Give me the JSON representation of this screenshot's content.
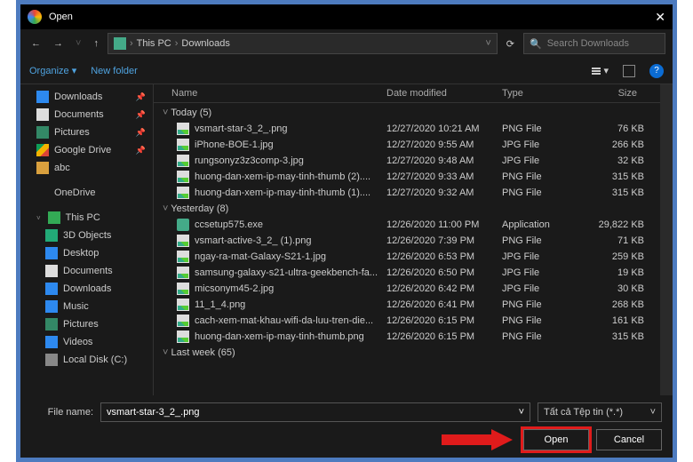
{
  "title": "Open",
  "breadcrumb": [
    "This PC",
    "Downloads"
  ],
  "search_placeholder": "Search Downloads",
  "toolbar": {
    "organize": "Organize",
    "newfolder": "New folder"
  },
  "columns": {
    "name": "Name",
    "date": "Date modified",
    "type": "Type",
    "size": "Size"
  },
  "sidebar": [
    {
      "icon": "dl",
      "label": "Downloads",
      "pin": true
    },
    {
      "icon": "doc",
      "label": "Documents",
      "pin": true
    },
    {
      "icon": "pic",
      "label": "Pictures",
      "pin": true
    },
    {
      "icon": "gd",
      "label": "Google Drive",
      "pin": true
    },
    {
      "icon": "fld",
      "label": "abc"
    },
    {
      "icon": "od",
      "label": "OneDrive",
      "spaced": true
    },
    {
      "icon": "pc",
      "label": "This PC",
      "spaced": true,
      "exp": true
    },
    {
      "icon": "obj",
      "label": "3D Objects",
      "sub": true
    },
    {
      "icon": "dsk",
      "label": "Desktop",
      "sub": true
    },
    {
      "icon": "doc",
      "label": "Documents",
      "sub": true
    },
    {
      "icon": "dl",
      "label": "Downloads",
      "sub": true
    },
    {
      "icon": "mus",
      "label": "Music",
      "sub": true
    },
    {
      "icon": "pic",
      "label": "Pictures",
      "sub": true
    },
    {
      "icon": "vid",
      "label": "Videos",
      "sub": true
    },
    {
      "icon": "dsk2",
      "label": "Local Disk (C:)",
      "sub": true
    }
  ],
  "groups": [
    {
      "label": "Today (5)",
      "files": [
        {
          "n": "vsmart-star-3_2_.png",
          "d": "12/27/2020 10:21 AM",
          "t": "PNG File",
          "s": "76 KB",
          "i": "img"
        },
        {
          "n": "iPhone-BOE-1.jpg",
          "d": "12/27/2020 9:55 AM",
          "t": "JPG File",
          "s": "266 KB",
          "i": "img"
        },
        {
          "n": "rungsonyz3z3comp-3.jpg",
          "d": "12/27/2020 9:48 AM",
          "t": "JPG File",
          "s": "32 KB",
          "i": "img"
        },
        {
          "n": "huong-dan-xem-ip-may-tinh-thumb (2)....",
          "d": "12/27/2020 9:33 AM",
          "t": "PNG File",
          "s": "315 KB",
          "i": "img"
        },
        {
          "n": "huong-dan-xem-ip-may-tinh-thumb (1)....",
          "d": "12/27/2020 9:32 AM",
          "t": "PNG File",
          "s": "315 KB",
          "i": "img"
        }
      ]
    },
    {
      "label": "Yesterday (8)",
      "files": [
        {
          "n": "ccsetup575.exe",
          "d": "12/26/2020 11:00 PM",
          "t": "Application",
          "s": "29,822 KB",
          "i": "exe"
        },
        {
          "n": "vsmart-active-3_2_ (1).png",
          "d": "12/26/2020 7:39 PM",
          "t": "PNG File",
          "s": "71 KB",
          "i": "img"
        },
        {
          "n": "ngay-ra-mat-Galaxy-S21-1.jpg",
          "d": "12/26/2020 6:53 PM",
          "t": "JPG File",
          "s": "259 KB",
          "i": "img"
        },
        {
          "n": "samsung-galaxy-s21-ultra-geekbench-fa...",
          "d": "12/26/2020 6:50 PM",
          "t": "JPG File",
          "s": "19 KB",
          "i": "img"
        },
        {
          "n": "micsonym45-2.jpg",
          "d": "12/26/2020 6:42 PM",
          "t": "JPG File",
          "s": "30 KB",
          "i": "img"
        },
        {
          "n": "11_1_4.png",
          "d": "12/26/2020 6:41 PM",
          "t": "PNG File",
          "s": "268 KB",
          "i": "img"
        },
        {
          "n": "cach-xem-mat-khau-wifi-da-luu-tren-die...",
          "d": "12/26/2020 6:15 PM",
          "t": "PNG File",
          "s": "161 KB",
          "i": "img"
        },
        {
          "n": "huong-dan-xem-ip-may-tinh-thumb.png",
          "d": "12/26/2020 6:15 PM",
          "t": "PNG File",
          "s": "315 KB",
          "i": "img"
        }
      ]
    },
    {
      "label": "Last week (65)"
    }
  ],
  "footer": {
    "filename_label": "File name:",
    "filename_value": "vsmart-star-3_2_.png",
    "filter": "Tất cả Tệp tin (*.*)",
    "open": "Open",
    "cancel": "Cancel"
  }
}
